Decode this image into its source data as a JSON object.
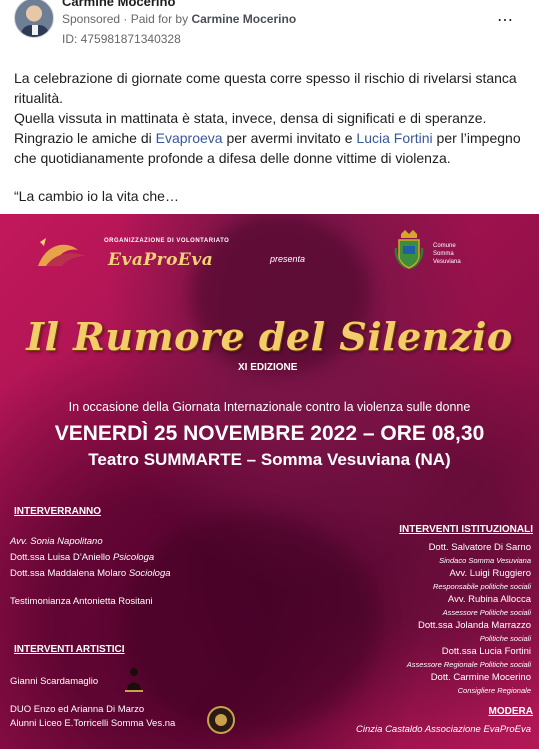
{
  "post": {
    "author": "Carmine Mocerino",
    "sponsored_label": "Sponsored",
    "separator": "·",
    "paid_for_prefix": "Paid for by",
    "paid_for_name": "Carmine Mocerino",
    "id_label": "ID: 475981871340328",
    "more_icon": "⋯",
    "text": {
      "p1": "La celebrazione di giornate come questa corre spesso il rischio di rivelarsi stanca ritualità.",
      "p2_a": "Quella vissuta in mattinata è stata, invece, densa di significati e di speranze.",
      "p3_a": "Ringrazio le amiche di ",
      "link1": "Evaproeva",
      "p3_b": " per avermi invitato e ",
      "link2": "Lucia Fortini",
      "p3_c": " per l’impegno che quotidianamente profonde a difesa delle donne vittime di violenza.",
      "quote": "“La cambio io la vita che…"
    }
  },
  "poster": {
    "org_small": "ORGANIZZAZIONE DI VOLONTARIATO",
    "org_name": "EvaProEva",
    "presenta": "presenta",
    "comune": [
      "Comune",
      "Somma",
      "Vesuviana"
    ],
    "title": "Il Rumore del Silenzio",
    "edition": "XI EDIZIONE",
    "occasion": "In occasione della Giornata Internazionale contro la violenza sulle donne",
    "date": "VENERDÌ 25 NOVEMBRE 2022 – ORE 08,30",
    "venue": "Teatro SUMMARTE – Somma Vesuviana (NA)",
    "interverranno_title": "INTERVERRANNO",
    "interverranno": [
      {
        "name": "Avv. Sonia Napolitano",
        "role": ""
      },
      {
        "name": "Dott.ssa Luisa D’Aniello ",
        "role": "Psicologa"
      },
      {
        "name": "Dott.ssa Maddalena Molaro ",
        "role": "Sociologa"
      }
    ],
    "testimonianza": "Testimonianza Antonietta Rositani",
    "artistici_title": "INTERVENTI ARTISTICI",
    "artistici": [
      "Gianni Scardamaglio",
      "DUO Enzo ed Arianna Di Marzo",
      "Alunni Liceo E.Torricelli Somma Ves.na"
    ],
    "istituzionali_title": "INTERVENTI ISTITUZIONALI",
    "istituzionali": [
      {
        "name": "Dott. Salvatore Di Sarno",
        "role": "Sindaco Somma Vesuviana"
      },
      {
        "name": "Avv. Luigi Ruggiero",
        "role": "Responsabile politiche sociali"
      },
      {
        "name": "Avv. Rubina Allocca",
        "role": "Assessore Politiche sociali"
      },
      {
        "name": "Dott.ssa Jolanda Marrazzo",
        "role": "Politiche sociali"
      },
      {
        "name": "Dott.ssa Lucia Fortini",
        "role": "Assessore Regionale Politiche sociali"
      },
      {
        "name": "Dott. Carmine Mocerino",
        "role": "Consigliere Regionale"
      }
    ],
    "moderatore_title": "MODERA",
    "moderatore": "Cinzia Castaldo Associazione EvaProEva"
  },
  "colors": {
    "link": "#385898",
    "poster_bg": "#b31756",
    "title_gold": "#f3cd6a"
  }
}
